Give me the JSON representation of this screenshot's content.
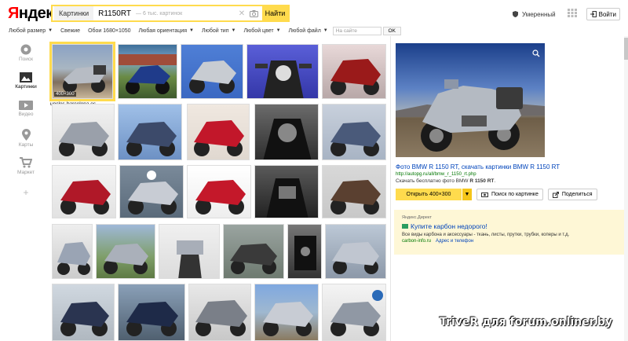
{
  "header": {
    "logo_text_red": "Я",
    "logo_text_rest": "ндекс",
    "search_tag": "Картинки",
    "query": "R1150RT",
    "hint": "— 6 тыс. картинок",
    "find_label": "Найти",
    "safe_search_label": "Умеренный",
    "login_label": "Войти"
  },
  "filters": {
    "items": [
      "Любой размер",
      "Свежие",
      "Обои 1680×1050",
      "Любая ориентация",
      "Любой тип",
      "Любой цвет",
      "Любой файл"
    ],
    "site_placeholder": "На сайте",
    "ok_label": "OK"
  },
  "nav": {
    "items": [
      {
        "label": "Поиск",
        "icon": "search-icon"
      },
      {
        "label": "Картинки",
        "icon": "images-icon"
      },
      {
        "label": "Видео",
        "icon": "video-icon"
      },
      {
        "label": "Карты",
        "icon": "map-pin-icon"
      },
      {
        "label": "Маркет",
        "icon": "cart-icon"
      }
    ],
    "add_label": "+"
  },
  "thumbnails": {
    "selected_size": "400×300",
    "selected_domain": "unclos-barcelona.es"
  },
  "preview": {
    "title": "Фото BMW R 1150 RT, скачать картинки BMW R 1150 RT",
    "url": "http://autopg.ru/all/bmw_r_1150_rt.php",
    "desc_prefix": "Скачать бесплатно фото BMW ",
    "desc_bold": "R 1150 RT",
    "desc_suffix": ".",
    "open_label": "Открыть 400×300",
    "similar_label": "Поиск по картинке",
    "share_label": "Поделиться"
  },
  "ad": {
    "label": "Яндекс.Директ",
    "title": "Купите карбон недорого!",
    "text": "Все виды карбона и аксессуары - ткань, листы, прутки, трубки, коперы и т.д.",
    "domain": "carbon-info.ru",
    "link": "Адрес и телефон"
  },
  "watermark": "TriveR для forum.onliner.by",
  "colors": {
    "accent": "#ffdb4d",
    "link": "#0044bb",
    "url": "#007700",
    "ad_bg": "#fef7d6"
  }
}
